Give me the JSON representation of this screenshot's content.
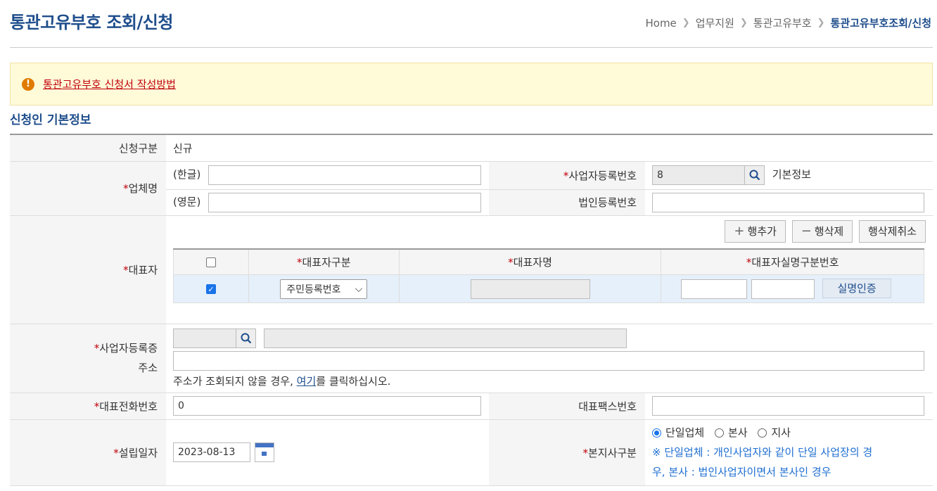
{
  "header": {
    "title": "통관고유부호 조회/신청",
    "breadcrumb": [
      "Home",
      "업무지원",
      "통관고유부호",
      "통관고유부호조회/신청"
    ]
  },
  "notice": {
    "icon": "exclamation-icon",
    "link": "통관고유부호 신청서 작성방법"
  },
  "section_title": "신청인 기본정보",
  "form": {
    "apply_type_label": "신청구분",
    "apply_type_value": "신규",
    "company_name_label": "업체명",
    "kor_label": "(한글)",
    "eng_label": "(영문)",
    "biz_no_label": "사업자등록번호",
    "biz_no_value": "8",
    "basic_info": "기본정보",
    "corp_no_label": "법인등록번호",
    "rep_label": "대표자",
    "add_row": "행추가",
    "delete_row": "행삭제",
    "cancel_delete": "행삭제취소",
    "grid_headers": [
      "대표자구분",
      "대표자명",
      "대표자실명구분번호"
    ],
    "rep_type_value": "주민등록번호",
    "verify_button": "실명인증",
    "address_label_1": "사업자등록증",
    "address_label_2": "주소",
    "address_hint_pre": "주소가 조회되지 않을 경우, ",
    "address_hint_link": "여기",
    "address_hint_post": "를 클릭하십시오.",
    "phone_label": "대표전화번호",
    "phone_value": "0",
    "fax_label": "대표팩스번호",
    "est_date_label": "설립일자",
    "est_date_value": "2023-08-13",
    "branch_label": "본지사구분",
    "branch_options": [
      "단일업체",
      "본사",
      "지사"
    ],
    "branch_selected": "단일업체",
    "branch_note_1": "※ 단일업체 : 개인사업자와 같이 단일 사업장의 경",
    "branch_note_2": "우, 본사 : 법인사업자이면서 본사인 경우"
  }
}
